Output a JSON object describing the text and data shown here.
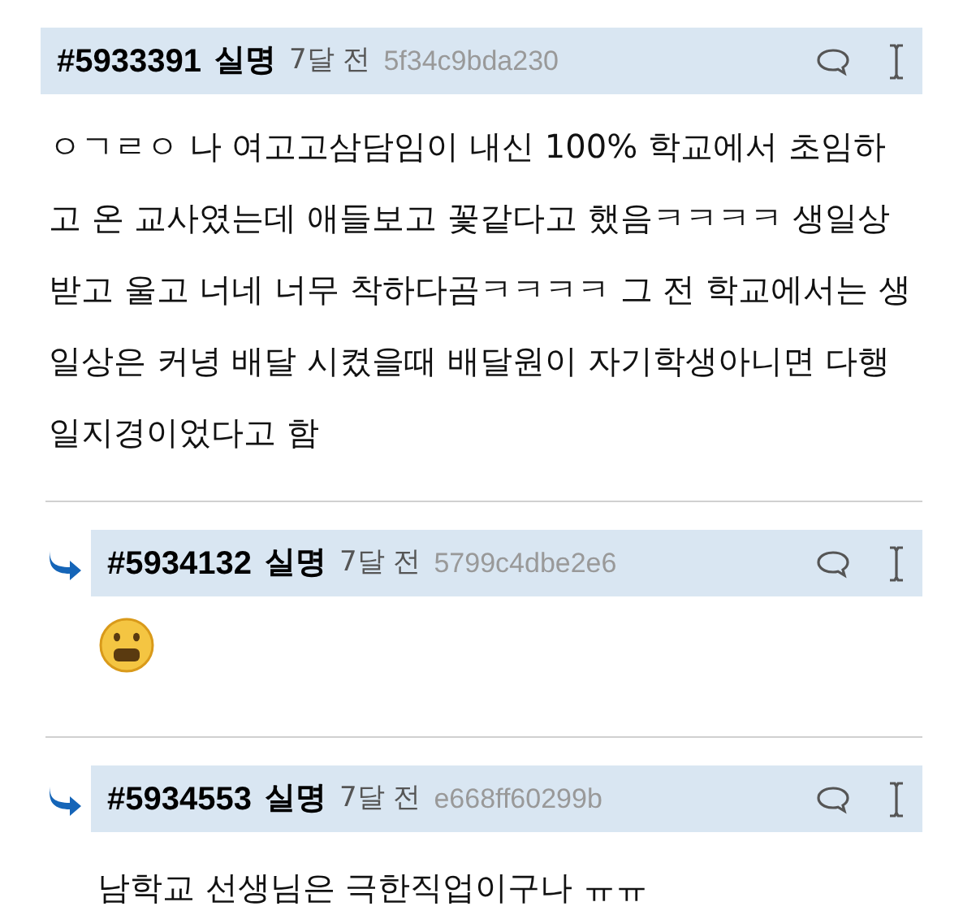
{
  "comments": [
    {
      "number": "#5933391",
      "author": "실명",
      "time": "7달 전",
      "hash": "5f34c9bda230",
      "reply": false,
      "body": [
        {
          "kind": "text",
          "text": "ㅇㄱㄹㅇ 나 여고고삼담임이 내신 100% 학교에서 초임하고 온 교사였는데 애들보고 꽃같다고 했음ㅋㅋㅋㅋ 생일상 받고 울고 너네 너무 착하다곰ㅋㅋㅋㅋ 그 전 학교에서는 생일상은 커녕 배달 시켰을때 배달원이 자기학생아니면 다행일지경이었다고 함"
        }
      ]
    },
    {
      "number": "#5934132",
      "author": "실명",
      "time": "7달 전",
      "hash": "5799c4dbe2e6",
      "reply": true,
      "body": [
        {
          "kind": "emoji"
        }
      ]
    },
    {
      "number": "#5934553",
      "author": "실명",
      "time": "7달 전",
      "hash": "e668ff60299b",
      "reply": true,
      "body": [
        {
          "kind": "text",
          "text": "남학교 선생님은 극한직업이구나 ㅠㅠ"
        }
      ]
    }
  ]
}
